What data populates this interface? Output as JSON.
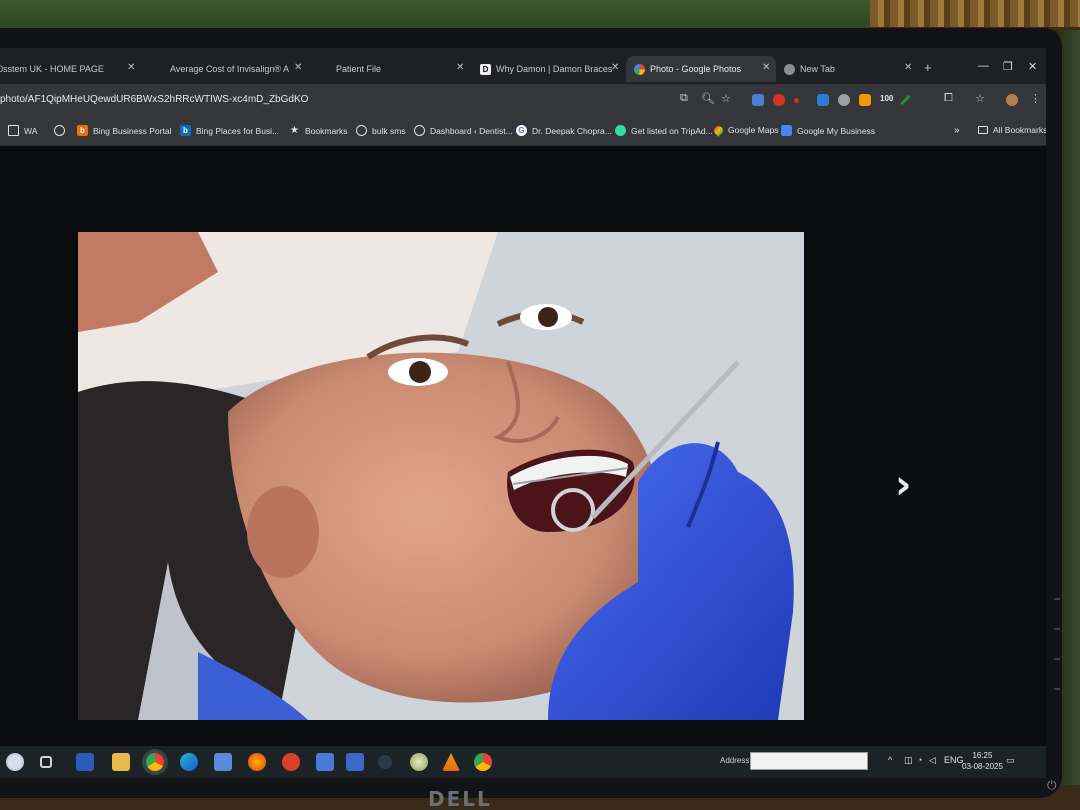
{
  "browser": {
    "tabs": [
      {
        "title": "0sstem UK - HOME PAGE",
        "active": false
      },
      {
        "title": "Average Cost of Invisalign® A",
        "active": false
      },
      {
        "title": "Patient File",
        "active": false
      },
      {
        "title": "Why Damon | Damon Braces",
        "active": false
      },
      {
        "title": "Photo - Google Photos",
        "active": true
      },
      {
        "title": "New Tab",
        "active": false
      }
    ],
    "new_tab": "+",
    "url": "photo/AF1QipMHeUQewdUR6BWxS2hRRcWTIWS-xc4mD_ZbGdKO",
    "bookmarks": [
      {
        "label": "WA",
        "icon": "folder-icon"
      },
      {
        "label": "",
        "icon": "globe-icon"
      },
      {
        "label": "Bing Business Portal",
        "icon": "bing-icon"
      },
      {
        "label": "Bing Places for Busi...",
        "icon": "bing-icon"
      },
      {
        "label": "Bookmarks",
        "icon": "star-icon"
      },
      {
        "label": "bulk sms",
        "icon": "globe-icon"
      },
      {
        "label": "Dashboard ‹ Dentist...",
        "icon": "globe-icon"
      },
      {
        "label": "Dr. Deepak Chopra...",
        "icon": "google-icon"
      },
      {
        "label": "Get listed on TripAd...",
        "icon": "tripadvisor-icon"
      },
      {
        "label": "Google Maps",
        "icon": "maps-icon"
      },
      {
        "label": "Google My Business",
        "icon": "business-icon"
      }
    ],
    "bookmarks_overflow": "»",
    "all_bookmarks": "All Bookmarks",
    "extension_badge": "100"
  },
  "viewer": {
    "next_label": "›"
  },
  "taskbar": {
    "address_label": "Address",
    "language": "ENG",
    "time": "16:25",
    "date": "03-08-2025"
  },
  "monitor": {
    "brand": "DELL"
  },
  "colors": {
    "glove": "#2f4fd8",
    "skin": "#c98a72",
    "chrome_dark": "#35363a"
  }
}
